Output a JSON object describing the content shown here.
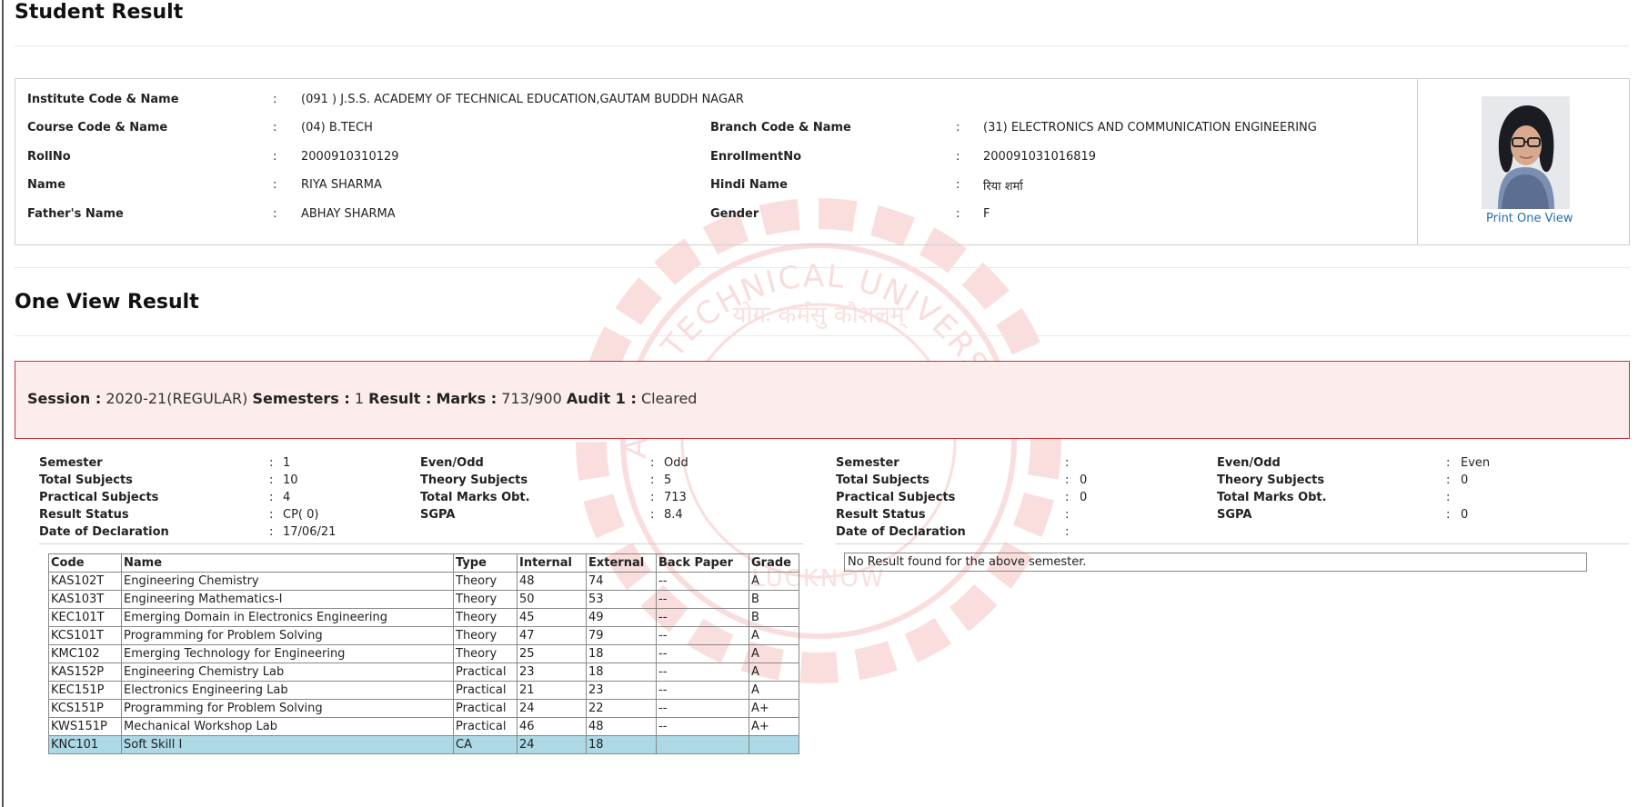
{
  "page": {
    "title": "Student Result",
    "section_title": "One View Result"
  },
  "profile": {
    "institute_label": "Institute Code & Name",
    "institute_value": "(091 ) J.S.S. ACADEMY OF TECHNICAL EDUCATION,GAUTAM BUDDH NAGAR",
    "course_label": "Course Code & Name",
    "course_value": "(04) B.TECH",
    "branch_label": "Branch Code & Name",
    "branch_value": "(31) ELECTRONICS AND COMMUNICATION ENGINEERING",
    "roll_label": "RollNo",
    "roll_value": "2000910310129",
    "enrollment_label": "EnrollmentNo",
    "enrollment_value": "200091031016819",
    "name_label": "Name",
    "name_value": "RIYA SHARMA",
    "hindi_label": "Hindi Name",
    "hindi_value": "रिया शर्मा",
    "father_label": "Father's Name",
    "father_value": "ABHAY SHARMA",
    "gender_label": "Gender",
    "gender_value": "F",
    "colon": ":",
    "print_link": "Print One View"
  },
  "banner": {
    "session_label": "Session :",
    "session_value": "2020-21(REGULAR)",
    "semesters_label": "Semesters :",
    "semesters_value": "1",
    "result_label": "Result :",
    "marks_label": "Marks :",
    "marks_value": "713/900",
    "audit_label": "Audit 1 :",
    "audit_value": "Cleared"
  },
  "sem_left": {
    "semester_label": "Semester",
    "semester_value": "1",
    "evenodd_label": "Even/Odd",
    "evenodd_value": "Odd",
    "total_subjects_label": "Total Subjects",
    "total_subjects_value": "10",
    "theory_label": "Theory Subjects",
    "theory_value": "5",
    "practical_label": "Practical Subjects",
    "practical_value": "4",
    "total_marks_label": "Total Marks Obt.",
    "total_marks_value": "713",
    "status_label": "Result Status",
    "status_value": "CP( 0)",
    "sgpa_label": "SGPA",
    "sgpa_value": "8.4",
    "declaration_label": "Date of Declaration",
    "declaration_value": "17/06/21"
  },
  "sem_right": {
    "semester_label": "Semester",
    "semester_value": "",
    "evenodd_label": "Even/Odd",
    "evenodd_value": "Even",
    "total_subjects_label": "Total Subjects",
    "total_subjects_value": "0",
    "theory_label": "Theory Subjects",
    "theory_value": "0",
    "practical_label": "Practical Subjects",
    "practical_value": "0",
    "total_marks_label": "Total Marks Obt.",
    "total_marks_value": "",
    "status_label": "Result Status",
    "status_value": "",
    "sgpa_label": "SGPA",
    "sgpa_value": "0",
    "declaration_label": "Date of Declaration",
    "declaration_value": "",
    "no_result": "No Result found for the above semester."
  },
  "marks_table": {
    "headers": [
      "Code",
      "Name",
      "Type",
      "Internal",
      "External",
      "Back Paper",
      "Grade"
    ],
    "rows": [
      [
        "KAS102T",
        "Engineering Chemistry",
        "Theory",
        "48",
        "74",
        "--",
        "A"
      ],
      [
        "KAS103T",
        "Engineering Mathematics-I",
        "Theory",
        "50",
        "53",
        "--",
        "B"
      ],
      [
        "KEC101T",
        "Emerging Domain in Electronics Engineering",
        "Theory",
        "45",
        "49",
        "--",
        "B"
      ],
      [
        "KCS101T",
        "Programming for Problem Solving",
        "Theory",
        "47",
        "79",
        "--",
        "A"
      ],
      [
        "KMC102",
        "Emerging Technology for Engineering",
        "Theory",
        "25",
        "18",
        "--",
        "A"
      ],
      [
        "KAS152P",
        "Engineering Chemistry Lab",
        "Practical",
        "23",
        "18",
        "--",
        "A"
      ],
      [
        "KEC151P",
        "Electronics Engineering Lab",
        "Practical",
        "21",
        "23",
        "--",
        "A"
      ],
      [
        "KCS151P",
        "Programming for Problem Solving",
        "Practical",
        "24",
        "22",
        "--",
        "A+"
      ],
      [
        "KWS151P",
        "Mechanical Workshop Lab",
        "Practical",
        "46",
        "48",
        "--",
        "A+"
      ],
      [
        "KNC101",
        "Soft Skill I",
        "CA",
        "24",
        "18",
        "",
        ""
      ]
    ]
  },
  "watermark": {
    "ring_text": "ALAM TECHNICAL UNIVERSITY",
    "motto": "योगः कर्मसु कौशलम्",
    "city": "LUCKNOW",
    "color": "#f3b3b3"
  },
  "colors": {
    "banner_border": "#c8323a",
    "banner_bg": "#fdecec",
    "link": "#1f6fb2",
    "highlight_row": "#add8e6"
  }
}
